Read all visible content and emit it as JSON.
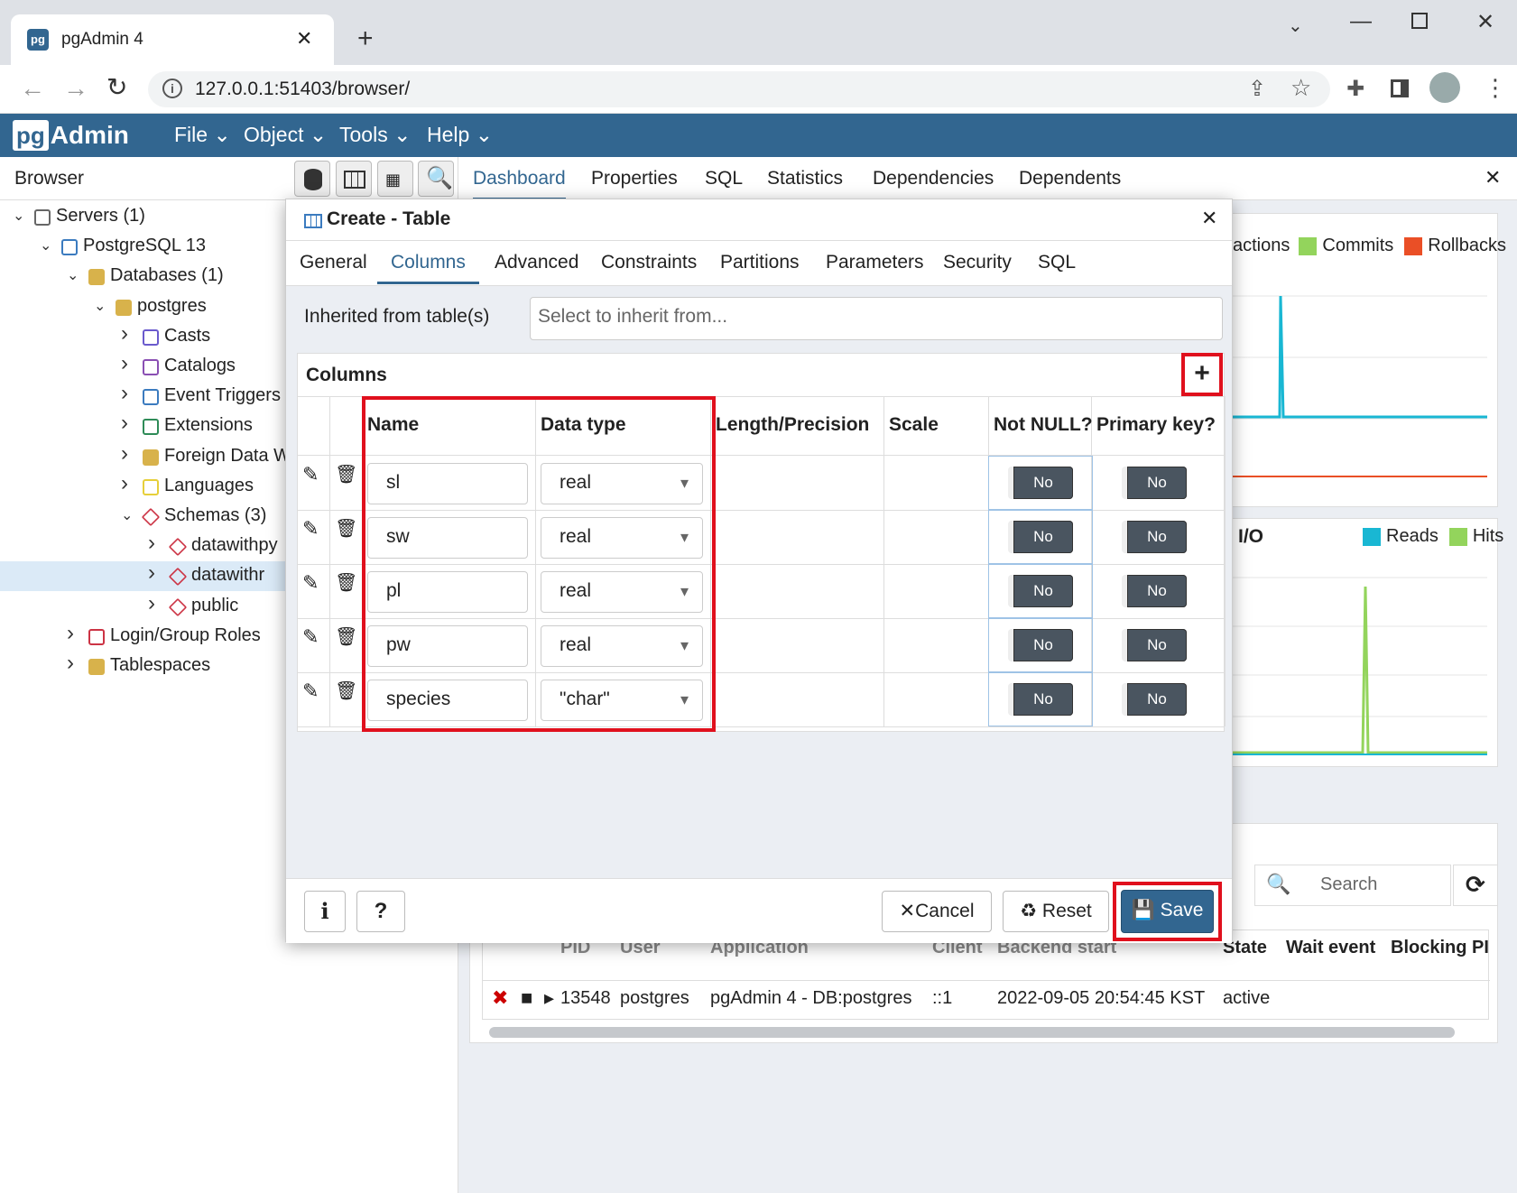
{
  "window": {
    "tab_title": "pgAdmin 4",
    "url": "127.0.0.1:51403/browser/"
  },
  "app": {
    "logo": "pgAdmin",
    "menu": [
      "File",
      "Object",
      "Tools",
      "Help"
    ]
  },
  "browser": {
    "title": "Browser",
    "tree": [
      {
        "label": "Servers (1)",
        "icon": "servers-icon",
        "expanded": true
      },
      {
        "label": "PostgreSQL 13",
        "icon": "postgresql-elephant-icon",
        "expanded": true
      },
      {
        "label": "Databases (1)",
        "icon": "databases-icon",
        "expanded": true
      },
      {
        "label": "postgres",
        "icon": "database-icon",
        "expanded": true
      },
      {
        "label": "Casts",
        "icon": "casts-icon",
        "expanded": false
      },
      {
        "label": "Catalogs",
        "icon": "catalogs-icon",
        "expanded": false
      },
      {
        "label": "Event Triggers",
        "icon": "event-triggers-icon",
        "expanded": false
      },
      {
        "label": "Extensions",
        "icon": "extensions-icon",
        "expanded": false
      },
      {
        "label": "Foreign Data W",
        "icon": "foreign-data-icon",
        "expanded": false
      },
      {
        "label": "Languages",
        "icon": "languages-icon",
        "expanded": false
      },
      {
        "label": "Schemas (3)",
        "icon": "schemas-icon",
        "expanded": true
      },
      {
        "label": "datawithpy",
        "icon": "schema-icon",
        "expanded": false
      },
      {
        "label": "datawithr",
        "icon": "schema-icon",
        "expanded": false,
        "selected": true
      },
      {
        "label": "public",
        "icon": "schema-icon",
        "expanded": false
      },
      {
        "label": "Login/Group Roles",
        "icon": "roles-icon",
        "expanded": false
      },
      {
        "label": "Tablespaces",
        "icon": "tablespaces-icon",
        "expanded": false
      }
    ]
  },
  "main_tabs": [
    "Dashboard",
    "Properties",
    "SQL",
    "Statistics",
    "Dependencies",
    "Dependents"
  ],
  "main_tabs_active": "Dashboard",
  "dashboard": {
    "tx_legend": [
      "actions",
      "Commits",
      "Rollbacks"
    ],
    "io_title": "I/O",
    "io_legend": [
      "Reads",
      "Hits"
    ],
    "search_placeholder": "Search",
    "activity_headers": [
      "PID",
      "User",
      "Application",
      "Client",
      "Backend start",
      "State",
      "Wait event",
      "Blocking PI"
    ],
    "activity_row": [
      "13548",
      "postgres",
      "pgAdmin 4 - DB:postgres",
      "::1",
      "2022-09-05 20:54:45 KST",
      "active",
      "",
      ""
    ],
    "colors": {
      "commits": "#93d45c",
      "rollbacks": "#ea4f26",
      "transactions": "#19b7d3",
      "reads": "#19b7d3",
      "hits": "#93d45c"
    }
  },
  "dialog": {
    "title": "Create - Table",
    "tabs": [
      "General",
      "Columns",
      "Advanced",
      "Constraints",
      "Partitions",
      "Parameters",
      "Security",
      "SQL"
    ],
    "active_tab": "Columns",
    "inherit_label": "Inherited from table(s)",
    "inherit_placeholder": "Select to inherit from...",
    "columns_section": "Columns",
    "column_headers": [
      "Name",
      "Data type",
      "Length/Precision",
      "Scale",
      "Not NULL?",
      "Primary key?"
    ],
    "rows": [
      {
        "name": "sl",
        "type": "real",
        "not_null": "No",
        "primary_key": "No"
      },
      {
        "name": "sw",
        "type": "real",
        "not_null": "No",
        "primary_key": "No"
      },
      {
        "name": "pl",
        "type": "real",
        "not_null": "No",
        "primary_key": "No"
      },
      {
        "name": "pw",
        "type": "real",
        "not_null": "No",
        "primary_key": "No"
      },
      {
        "name": "species",
        "type": "\"char\"",
        "not_null": "No",
        "primary_key": "No"
      }
    ],
    "buttons": {
      "info": "i",
      "help": "?",
      "cancel": "Cancel",
      "reset": "Reset",
      "save": "Save"
    },
    "highlight_color": "#e0101d",
    "save_color": "#326690"
  }
}
